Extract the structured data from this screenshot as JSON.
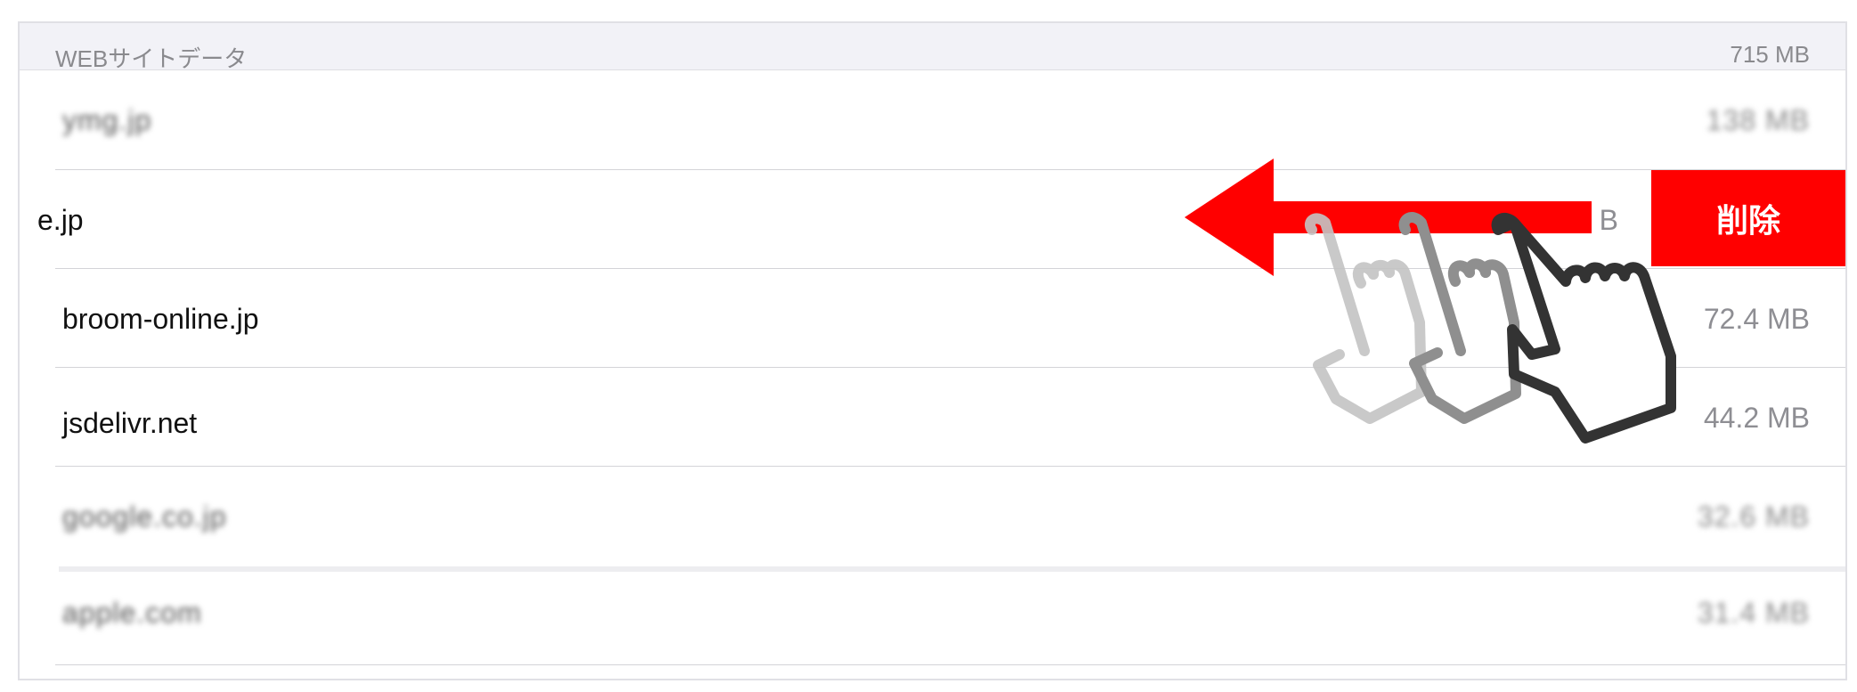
{
  "section": {
    "title": "WEBサイトデータ",
    "total": "715 MB"
  },
  "rows": [
    {
      "domain": "ymg.jp",
      "size": "138 MB",
      "obscured": true
    },
    {
      "domain": "e.jp",
      "size": "B",
      "swiped": true
    },
    {
      "domain": "broom-online.jp",
      "size": "72.4 MB"
    },
    {
      "domain": "jsdelivr.net",
      "size": "44.2 MB"
    },
    {
      "domain": "google.co.jp",
      "size": "32.6 MB",
      "obscured": true
    },
    {
      "domain": "apple.com",
      "size": "31.4 MB",
      "obscured": true
    }
  ],
  "swipe_action": {
    "delete_label": "削除",
    "color": "#ff0000"
  },
  "gesture": {
    "arrow_color": "#ff0000",
    "direction": "left",
    "icon": "swipe-left-hand-icon"
  }
}
